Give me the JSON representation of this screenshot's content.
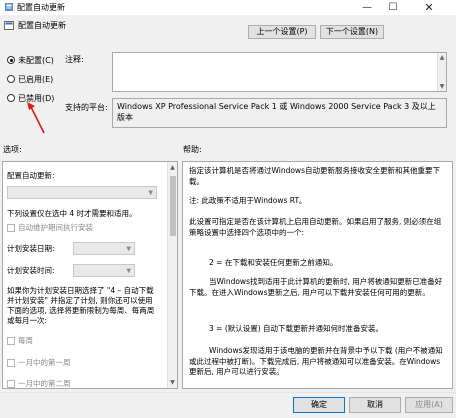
{
  "window": {
    "title": "配置自动更新",
    "min": "—",
    "max": "☐",
    "close": "✕"
  },
  "header": {
    "title": "配置自动更新"
  },
  "nav": {
    "prev": "上一个设置(P)",
    "next": "下一个设置(N)"
  },
  "state": {
    "options": [
      {
        "label": "未配置(C)",
        "checked": true
      },
      {
        "label": "已启用(E)",
        "checked": false
      },
      {
        "label": "已禁用(D)",
        "checked": false
      }
    ]
  },
  "labels": {
    "comment": "注释:",
    "platform": "支持的平台:",
    "options": "选项:",
    "help": "帮助:"
  },
  "platform_text": "Windows XP Professional Service Pack 1 或 Windows 2000 Service Pack 3 及以上版本",
  "options_panel": {
    "configure_label": "配置自动更新:",
    "install_day_hint": "下列设置仅在选中 4 时才需要和适用。",
    "maintenance_checkbox": "自动维护期间执行安装",
    "schedule_day": "计划安装日期:",
    "schedule_time": "计划安装时间:",
    "note": [
      "如果你为计划安装日期选择了 \"4 – 自动下载",
      "并计划安装\" 并指定了计划, 则你还可以使用",
      "下面的选项, 选择将更新限制为每周、每两周",
      "或每月一次:"
    ],
    "weekly": "每周",
    "first_week": "一月中的第一周",
    "second_week": "一月中的第二周"
  },
  "help_panel": {
    "paragraphs": [
      "指定该计算机是否将通过Windows自动更新服务接收安全更新和其他重要下载。",
      "注: 此政策不适用于Windows RT。",
      "此设置可指定是否在该计算机上启用自动更新。如果启用了服务, 则必须在组策略设置中选择四个选项中的一个:",
      "2 = 在下载和安装任何更新之前通知。",
      "当Windows找到适用于此计算机的更新时, 用户将被通知更新已准备好下载。在进入Windows更新之后, 用户可以下载并安装任何可用的更新。",
      "3 = (默认设置) 自动下载更新并通知何时准备安装。",
      "Windows发现适用于该电脑的更新并在背景中予以下载 (用户不被通知或此过程中被打断)。下载完成后, 用户将被通知可以准备安装。在Windows更新后, 用户可以进行安装。"
    ]
  },
  "footer": {
    "ok": "确定",
    "cancel": "取消",
    "apply": "应用(A)"
  }
}
